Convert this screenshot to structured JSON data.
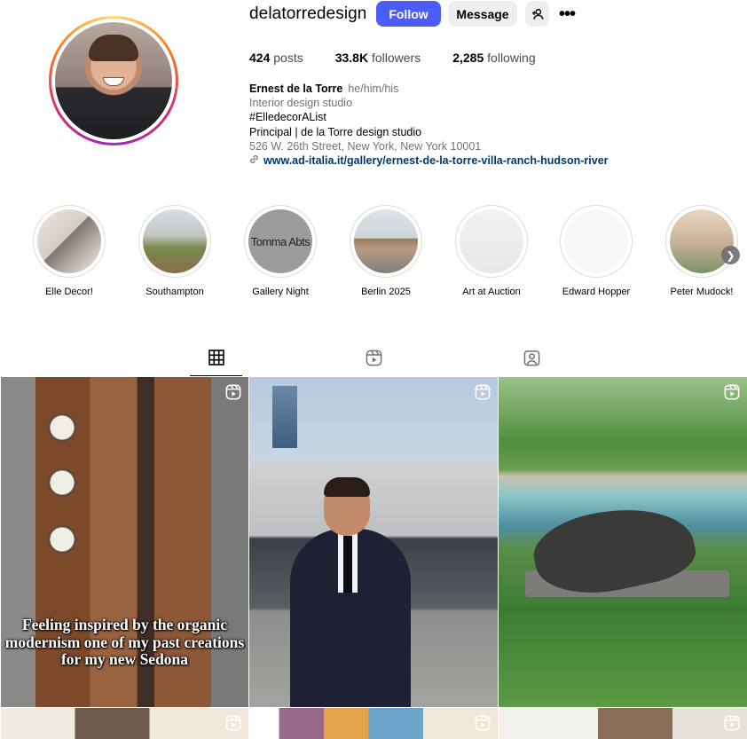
{
  "profile": {
    "username": "delatorredesign",
    "follow_label": "Follow",
    "message_label": "Message",
    "stats": {
      "posts_count": "424",
      "posts_label": "posts",
      "followers_count": "33.8K",
      "followers_label": "followers",
      "following_count": "2,285",
      "following_label": "following"
    },
    "bio": {
      "name": "Ernest de la Torre",
      "pronouns": "he/him/his",
      "category": "Interior design studio",
      "line1": "#ElledecorAList",
      "line2": "Principal | de la Torre design studio",
      "address": "526 W. 26th Street, New York, New York 10001",
      "link": "www.ad-italia.it/gallery/ernest-de-la-torre-villa-ranch-hudson-river"
    }
  },
  "highlights": [
    {
      "label": "Elle Decor!"
    },
    {
      "label": "Southampton"
    },
    {
      "label": "Gallery Night",
      "image_text": "Tomma Abts"
    },
    {
      "label": "Berlin 2025"
    },
    {
      "label": "Art at Auction"
    },
    {
      "label": "Edward Hopper"
    },
    {
      "label": "Peter Mudock!"
    }
  ],
  "tabs": [
    {
      "icon": "grid-icon",
      "active": true
    },
    {
      "icon": "reels-icon",
      "active": false
    },
    {
      "icon": "tagged-icon",
      "active": false
    }
  ],
  "posts": [
    {
      "type": "reel",
      "caption": "Feeling inspired by the organic modernism one of my past creations for my new Sedona"
    },
    {
      "type": "reel"
    },
    {
      "type": "reel"
    },
    {
      "type": "reel"
    },
    {
      "type": "reel"
    },
    {
      "type": "reel"
    }
  ],
  "colors": {
    "follow_button": "#4a5df9",
    "link": "#00376b",
    "secondary_text": "#737373"
  }
}
